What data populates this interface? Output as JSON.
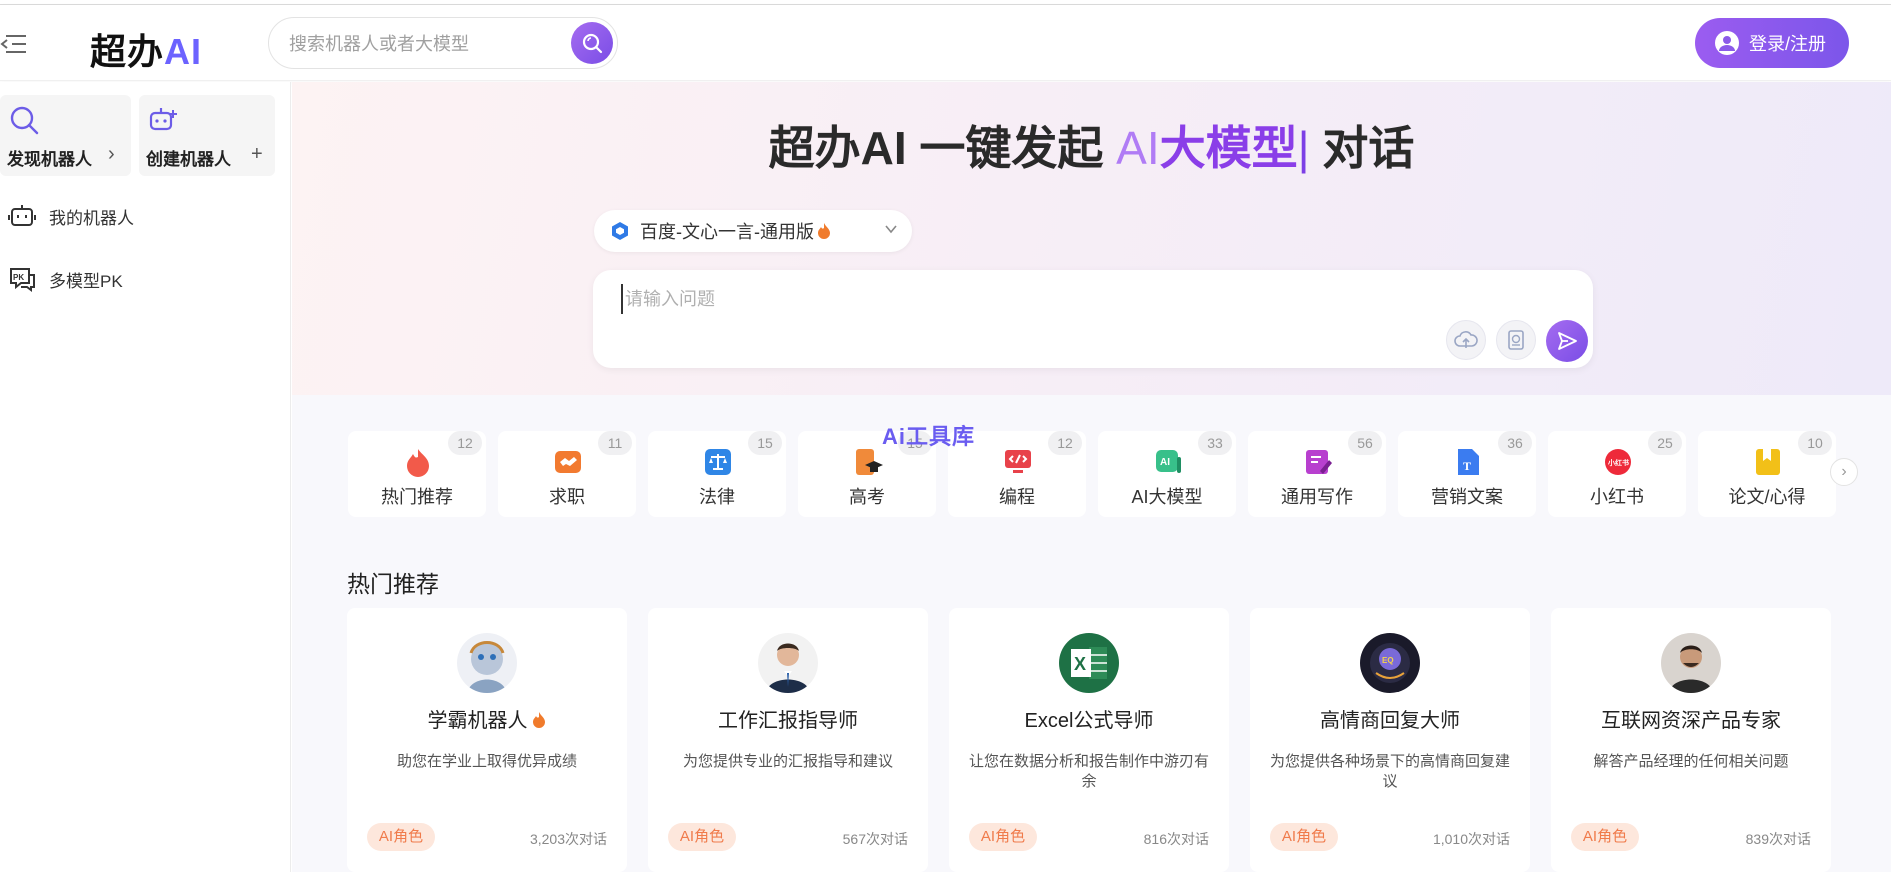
{
  "header": {
    "logo_main": "超办",
    "logo_ai": "AI",
    "search_placeholder": "搜索机器人或者大模型",
    "login_label": "登录/注册"
  },
  "sidebar": {
    "discover_label": "发现机器人",
    "create_label": "创建机器人",
    "items": [
      {
        "label": "我的机器人",
        "icon": "robot-icon"
      },
      {
        "label": "多模型PK",
        "icon": "pk-icon"
      }
    ]
  },
  "hero": {
    "title_prefix": "超办AI 一键发起 ",
    "title_hl1": "AI",
    "title_hl2": "大模型",
    "title_cursor": "|",
    "title_suffix": " 对话",
    "model_name": "百度-文心一言-通用版",
    "ask_placeholder": "请输入问题"
  },
  "watermark": "Ai工具库",
  "categories": [
    {
      "label": "热门推荐",
      "count": "12",
      "icon": "fire-icon",
      "color": "#f25a4a"
    },
    {
      "label": "求职",
      "count": "11",
      "icon": "handshake-icon",
      "color": "#f27a30"
    },
    {
      "label": "法律",
      "count": "15",
      "icon": "scale-icon",
      "color": "#2f86e6"
    },
    {
      "label": "高考",
      "count": "15",
      "icon": "graduation-icon",
      "color": "#f08a3a"
    },
    {
      "label": "编程",
      "count": "12",
      "icon": "code-icon",
      "color": "#e8424a"
    },
    {
      "label": "AI大模型",
      "count": "33",
      "icon": "ai-model-icon",
      "color": "#38c08a"
    },
    {
      "label": "通用写作",
      "count": "56",
      "icon": "writing-icon",
      "color": "#b83fcf"
    },
    {
      "label": "营销文案",
      "count": "36",
      "icon": "document-icon",
      "color": "#3b7cf0"
    },
    {
      "label": "小红书",
      "count": "25",
      "icon": "xiaohongshu-icon",
      "color": "#ee2a3a"
    },
    {
      "label": "论文/心得",
      "count": "10",
      "icon": "bookmark-icon",
      "color": "#f2c018"
    }
  ],
  "section_title": "热门推荐",
  "bots": [
    {
      "name": "学霸机器人",
      "desc": "助您在学业上取得优异成绩",
      "tag": "AI角色",
      "count": "3,203次对话",
      "avatar": "robot-face-avatar"
    },
    {
      "name": "工作汇报指导师",
      "desc": "为您提供专业的汇报指导和建议",
      "tag": "AI角色",
      "count": "567次对话",
      "avatar": "businessman-avatar"
    },
    {
      "name": "Excel公式导师",
      "desc": "让您在数据分析和报告制作中游刃有余",
      "tag": "AI角色",
      "count": "816次对话",
      "avatar": "excel-avatar"
    },
    {
      "name": "高情商回复大师",
      "desc": "为您提供各种场景下的高情商回复建议",
      "tag": "AI角色",
      "count": "1,010次对话",
      "avatar": "brain-avatar"
    },
    {
      "name": "互联网资深产品专家",
      "desc": "解答产品经理的任何相关问题",
      "tag": "AI角色",
      "count": "839次对话",
      "avatar": "expert-avatar"
    }
  ]
}
